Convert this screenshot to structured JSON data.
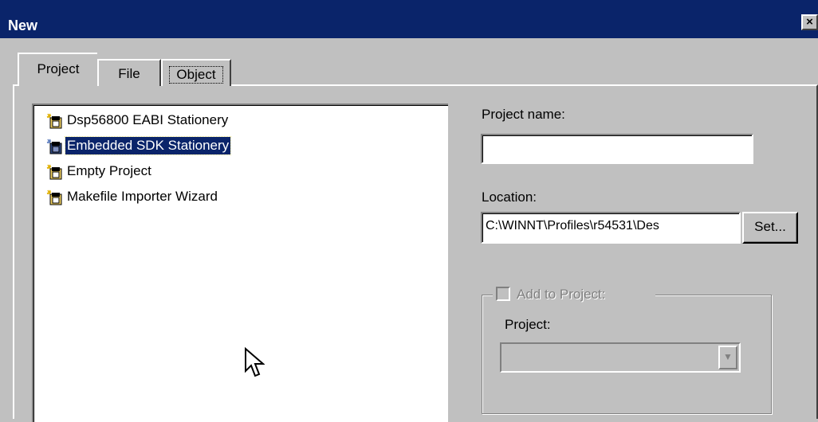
{
  "window": {
    "title": "New",
    "close_glyph": "×"
  },
  "tabs": [
    {
      "label": "Project",
      "active": true
    },
    {
      "label": "File",
      "active": false
    },
    {
      "label": "Object",
      "active": false
    }
  ],
  "stationery_list": {
    "items": [
      {
        "label": "Dsp56800 EABI Stationery",
        "icon": "stationery-icon",
        "selected": false
      },
      {
        "label": "Embedded SDK Stationery",
        "icon": "stationery-icon",
        "selected": true
      },
      {
        "label": "Empty Project",
        "icon": "stationery-icon",
        "selected": false
      },
      {
        "label": "Makefile Importer Wizard",
        "icon": "wizard-icon",
        "selected": false
      }
    ]
  },
  "project_name": {
    "label": "Project name:",
    "value": ""
  },
  "location": {
    "label": "Location:",
    "value": "C:\\WINNT\\Profiles\\r54531\\Des",
    "set_label": "Set..."
  },
  "add_to_project": {
    "label": "Add to Project:",
    "checked": false,
    "enabled": false,
    "project_label": "Project:",
    "project_value": ""
  },
  "colors": {
    "titlebar": "#0a246a",
    "face": "#c0c0c0",
    "selection": "#0a246a"
  }
}
